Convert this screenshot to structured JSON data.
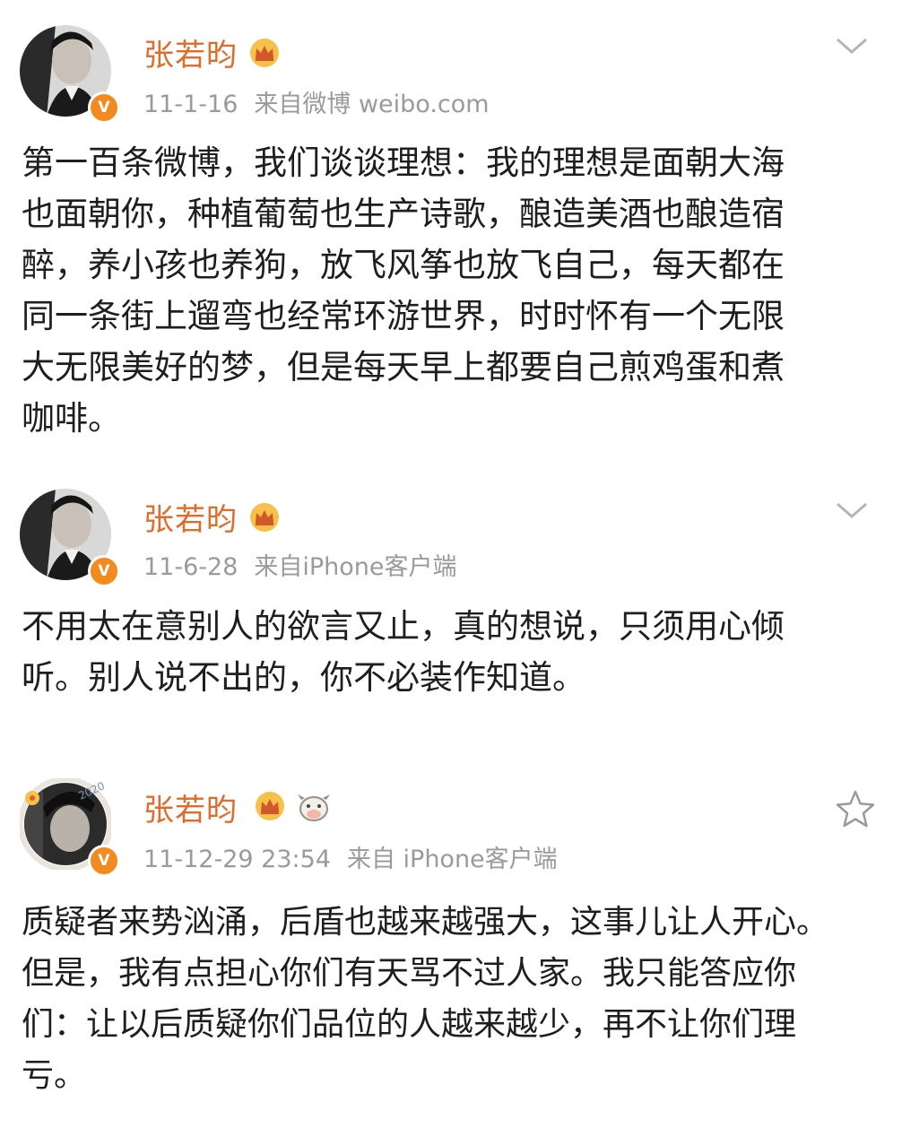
{
  "posts": [
    {
      "username": "张若昀",
      "date": "11-1-16",
      "source": "来自微博 weibo.com",
      "text": "第一百条微博，我们谈谈理想：我的理想是面朝大海\n也面朝你，种植葡萄也生产诗歌，酿造美酒也酿造宿\n醉，养小孩也养狗，放飞风筝也放飞自己，每天都在\n同一条街上遛弯也经常环游世界，时时怀有一个无限\n大无限美好的梦，但是每天早上都要自己煎鸡蛋和煮\n咖啡。",
      "action_icon": "chevron-down-icon"
    },
    {
      "username": "张若昀",
      "date": "11-6-28",
      "source": "来自iPhone客户端",
      "text": "不用太在意别人的欲言又止，真的想说，只须用心倾\n听。别人说不出的，你不必装作知道。",
      "action_icon": "chevron-down-icon"
    },
    {
      "username": "张若昀",
      "date": "11-12-29 23:54",
      "source": "来自 iPhone客户端",
      "text": "质疑者来势汹涌，后盾也越来越强大，这事儿让人开心。\n但是，我有点担心你们有天骂不过人家。我只能答应你\n们：让以后质疑你们品位的人越来越少，再不让你们理\n亏。",
      "action_icon": "star-icon"
    }
  ],
  "badge_text": "V",
  "avatar_frame_text": "2020",
  "colors": {
    "username": "#e06b2a",
    "meta": "#9a9a9a",
    "body": "#1e1e1e",
    "badge": "#f28a1e"
  }
}
